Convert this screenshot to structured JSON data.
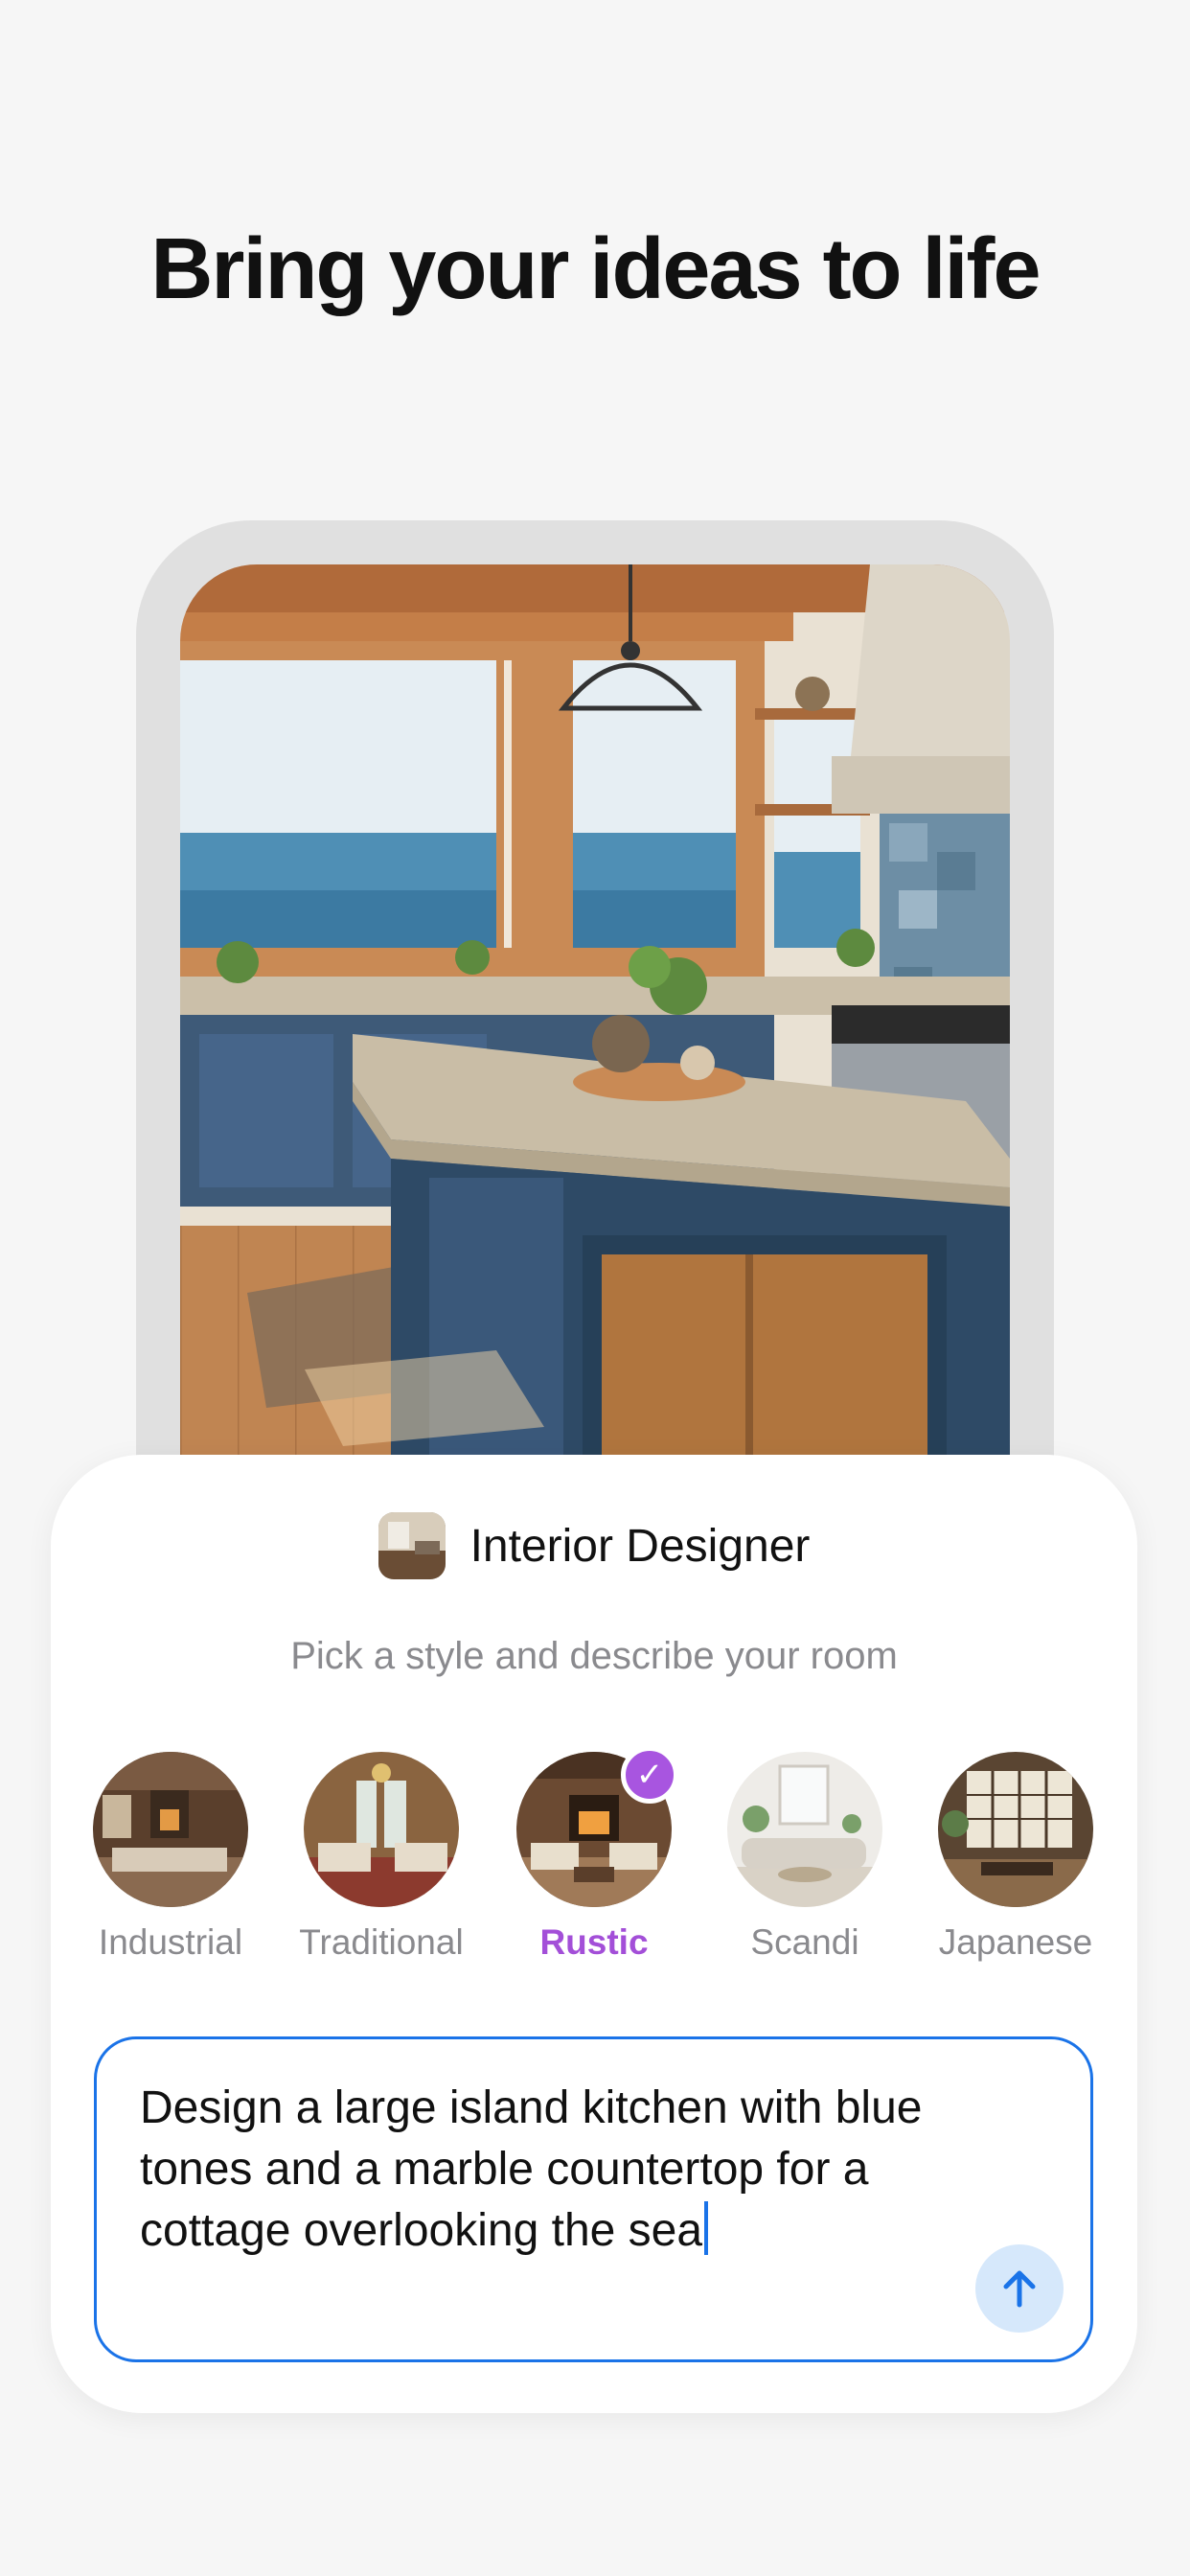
{
  "headline": "Bring your ideas to life",
  "preview": {
    "image": "rustic-coastal-kitchen-photo"
  },
  "card": {
    "app_icon": "interior-room-thumbnail",
    "app_name": "Interior Designer",
    "subtitle": "Pick a style and describe your room",
    "styles": [
      {
        "label": "Industrial",
        "selected": false
      },
      {
        "label": "Traditional",
        "selected": false
      },
      {
        "label": "Rustic",
        "selected": true
      },
      {
        "label": "Scandi",
        "selected": false
      },
      {
        "label": "Japanese",
        "selected": false
      }
    ],
    "check_icon": "✓",
    "prompt": {
      "value": "Design a large island kitchen with blue tones and a marble countertop for a cottage overlooking the sea",
      "send_icon": "arrow-up-icon"
    }
  },
  "colors": {
    "accent_purple": "#a855e0",
    "accent_blue": "#1a73e8",
    "send_bg": "#d6e8fb"
  }
}
